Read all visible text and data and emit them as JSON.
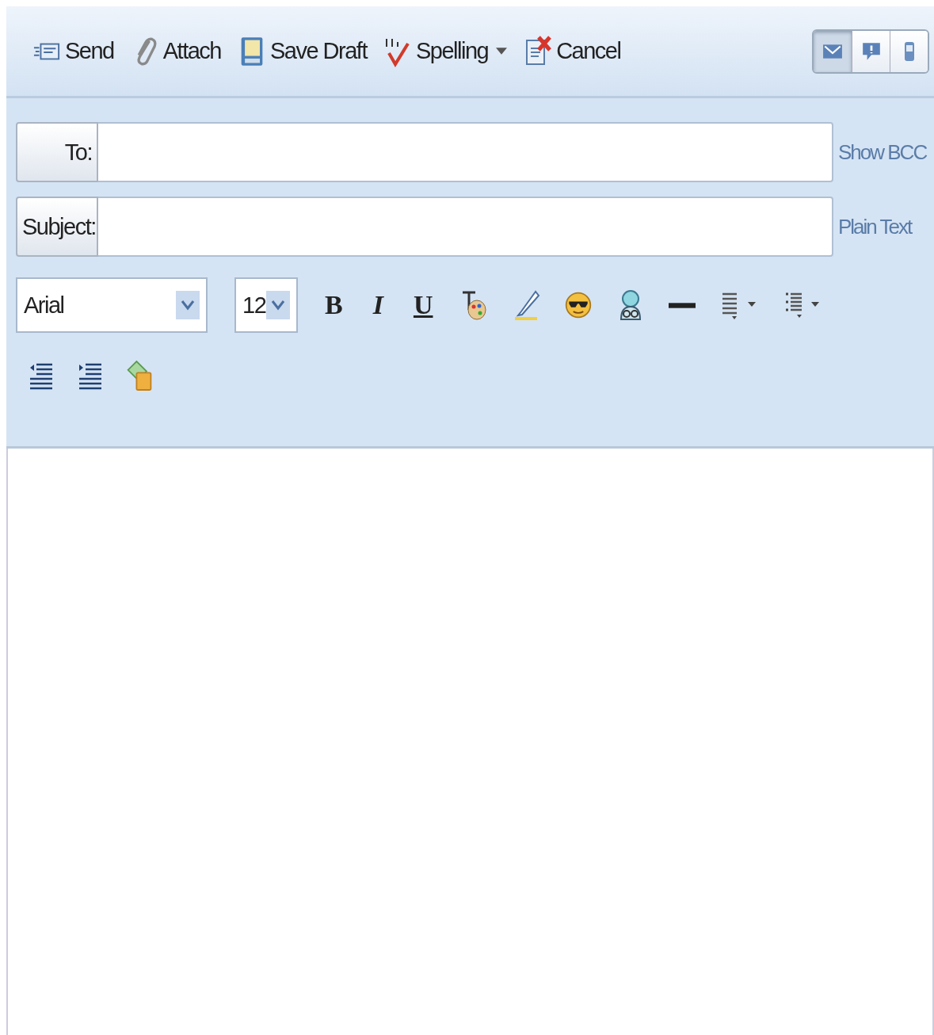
{
  "toolbar": {
    "buttons": [
      {
        "kind": "send",
        "label": "Send",
        "menu": false
      },
      {
        "kind": "attach",
        "label": "Attach",
        "menu": false
      },
      {
        "kind": "save",
        "label": "Save Draft",
        "menu": false
      },
      {
        "kind": "spelling",
        "label": "Spelling",
        "menu": true
      },
      {
        "kind": "cancel",
        "label": "Cancel",
        "menu": false
      }
    ],
    "views": [
      {
        "kind": "mail",
        "selected": true
      },
      {
        "kind": "chat",
        "selected": false
      },
      {
        "kind": "phone",
        "selected": false
      }
    ]
  },
  "fields": [
    {
      "label": "To:",
      "link": "Show BCC"
    },
    {
      "label": "Subject:",
      "link": "Plain Text"
    }
  ],
  "format": {
    "font": "Arial",
    "size": "12",
    "styles": [
      {
        "kind": "bold",
        "label": "B"
      },
      {
        "kind": "italic",
        "label": "I"
      },
      {
        "kind": "underline",
        "label": "U"
      }
    ]
  }
}
